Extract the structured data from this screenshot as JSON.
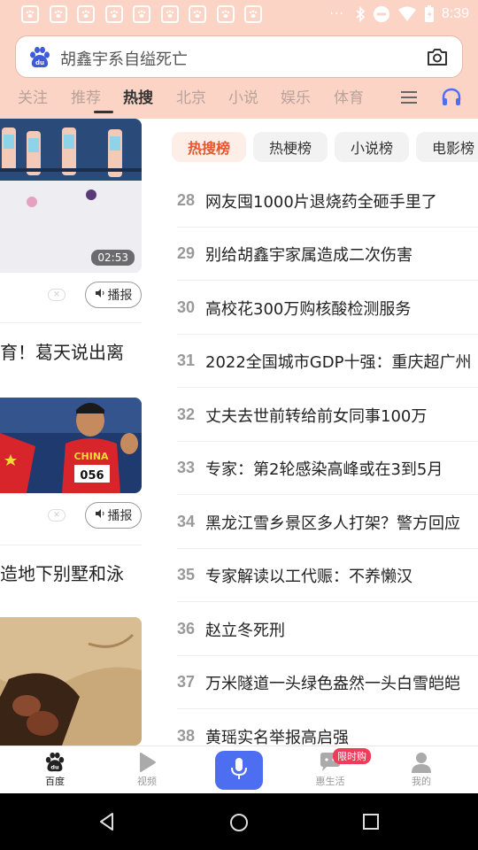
{
  "status_bar": {
    "time": "8:39",
    "dots": "···"
  },
  "search": {
    "query": "胡鑫宇系自缢死亡"
  },
  "tabs": [
    {
      "label": "关注",
      "active": false
    },
    {
      "label": "推荐",
      "active": false
    },
    {
      "label": "热搜",
      "active": true
    },
    {
      "label": "北京",
      "active": false
    },
    {
      "label": "小说",
      "active": false
    },
    {
      "label": "娱乐",
      "active": false
    },
    {
      "label": "体育",
      "active": false
    }
  ],
  "left_feed": {
    "items": [
      {
        "duration": "02:53",
        "broadcast_label": "播报",
        "title": "育！葛天说出离"
      },
      {
        "broadcast_label": "播报",
        "title": "造地下别墅和泳"
      }
    ],
    "jersey_text": "CHINA",
    "bib_number": "056"
  },
  "hot_tabs": [
    "热搜榜",
    "热梗榜",
    "小说榜",
    "电影榜"
  ],
  "hot_list": [
    {
      "rank": "28",
      "text": "网友囤1000片退烧药全砸手里了"
    },
    {
      "rank": "29",
      "text": "别给胡鑫宇家属造成二次伤害"
    },
    {
      "rank": "30",
      "text": "高校花300万购核酸检测服务"
    },
    {
      "rank": "31",
      "text": "2022全国城市GDP十强：重庆超广州"
    },
    {
      "rank": "32",
      "text": "丈夫去世前转给前女同事100万"
    },
    {
      "rank": "33",
      "text": "专家：第2轮感染高峰或在3到5月"
    },
    {
      "rank": "34",
      "text": "黑龙江雪乡景区多人打架？警方回应"
    },
    {
      "rank": "35",
      "text": "专家解读以工代赈：不养懒汉"
    },
    {
      "rank": "36",
      "text": "赵立冬死刑"
    },
    {
      "rank": "37",
      "text": "万米隧道一头绿色盎然一头白雪皑皑"
    },
    {
      "rank": "38",
      "text": "黄瑶实名举报高启强"
    }
  ],
  "bottom_nav": {
    "items": [
      {
        "label": "百度",
        "icon": "baidu-paw-icon",
        "active": true
      },
      {
        "label": "视频",
        "icon": "video-play-icon",
        "active": false
      },
      {
        "label": "惠生活",
        "icon": "chat-bubble-icon",
        "active": false
      },
      {
        "label": "我的",
        "icon": "profile-icon",
        "active": false
      }
    ],
    "promo_badge": "限时购"
  },
  "colors": {
    "header_bg": "#fbd4c6",
    "accent": "#e8562a",
    "mic_blue": "#4e6ef2",
    "badge_red": "#f03c5a"
  }
}
